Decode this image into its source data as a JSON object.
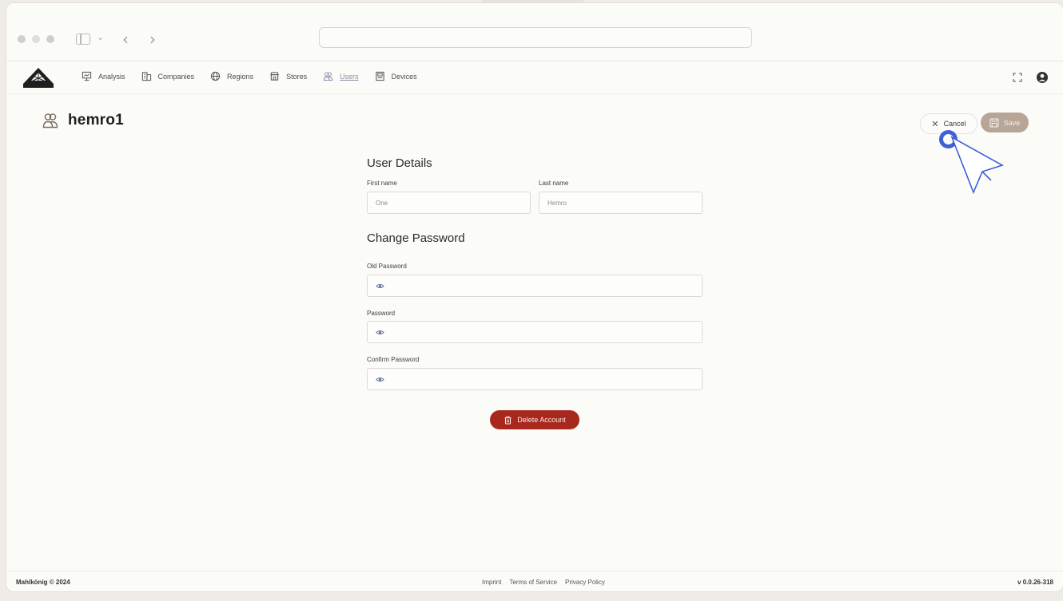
{
  "browser": {
    "address": ""
  },
  "nav": {
    "logo_alt": "Mahlkönig logo",
    "items": [
      {
        "label": "Analysis",
        "icon": "presentation-icon"
      },
      {
        "label": "Companies",
        "icon": "buildings-icon"
      },
      {
        "label": "Regions",
        "icon": "globe-icon"
      },
      {
        "label": "Stores",
        "icon": "store-icon"
      },
      {
        "label": "Users",
        "icon": "users-icon",
        "active": true
      },
      {
        "label": "Devices",
        "icon": "device-icon"
      }
    ]
  },
  "page": {
    "title": "hemro1",
    "cancel_label": "Cancel",
    "save_label": "Save"
  },
  "user_details": {
    "heading": "User Details",
    "first_name_label": "First name",
    "first_name_value": "One",
    "last_name_label": "Last name",
    "last_name_value": "Hemro"
  },
  "change_password": {
    "heading": "Change Password",
    "old_password_label": "Old Password",
    "password_label": "Password",
    "confirm_password_label": "Confirm Password"
  },
  "delete_label": "Delete Account",
  "footer": {
    "copyright": "Mahlkönig © 2024",
    "links": [
      "Imprint",
      "Terms of Service",
      "Privacy Policy"
    ],
    "version": "v 0.0.26-318"
  },
  "colors": {
    "accent_save": "#b7a597",
    "danger": "#a8281e",
    "cursor": "#3f5fd6"
  }
}
